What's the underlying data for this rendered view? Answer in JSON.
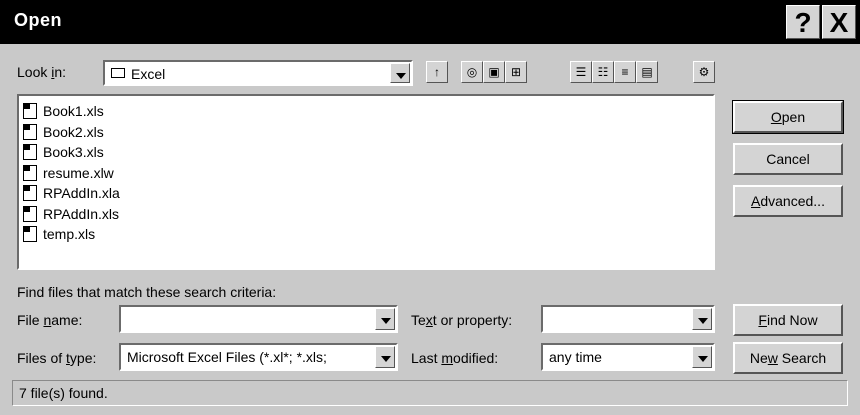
{
  "window": {
    "title": "Open",
    "help_button": "?",
    "close_button": "X"
  },
  "look_in": {
    "label_pre": "Look ",
    "label_key": "i",
    "label_post": "n:",
    "value": "Excel"
  },
  "toolbar": {
    "icons": [
      "up-one-level-icon",
      "search-web-icon",
      "look-in-favorites-icon",
      "add-to-favorites-icon",
      "list-view-icon",
      "details-view-icon",
      "properties-view-icon",
      "preview-view-icon",
      "commands-settings-icon"
    ]
  },
  "files": [
    {
      "name": "Book1.xls",
      "icon": "excel-workbook-icon"
    },
    {
      "name": "Book2.xls",
      "icon": "excel-workbook-icon"
    },
    {
      "name": "Book3.xls",
      "icon": "excel-workbook-icon"
    },
    {
      "name": "resume.xlw",
      "icon": "excel-workspace-icon"
    },
    {
      "name": "RPAddIn.xla",
      "icon": "excel-addin-icon"
    },
    {
      "name": "RPAddIn.xls",
      "icon": "excel-workbook-icon"
    },
    {
      "name": "temp.xls",
      "icon": "excel-workbook-icon"
    }
  ],
  "buttons": {
    "open": {
      "key": "O",
      "rest": "pen"
    },
    "cancel": "Cancel",
    "advanced": {
      "key": "A",
      "rest": "dvanced..."
    },
    "find_now": {
      "key": "F",
      "rest": "ind Now"
    },
    "new_search": {
      "pre": "Ne",
      "key": "w",
      "post": " Search"
    }
  },
  "search": {
    "criteria_label": "Find files that match these search criteria:",
    "file_name": {
      "pre": "File ",
      "key": "n",
      "post": "ame:",
      "value": ""
    },
    "text_property": {
      "pre": "Te",
      "key": "x",
      "post": "t or property:",
      "value": ""
    },
    "files_of_type": {
      "pre": "Files of ",
      "key": "t",
      "post": "ype:",
      "value": "Microsoft Excel Files (*.xl*; *.xls;"
    },
    "last_modified": {
      "pre": "Last ",
      "key": "m",
      "post": "odified:",
      "value": "any time"
    }
  },
  "status": "7 file(s) found."
}
